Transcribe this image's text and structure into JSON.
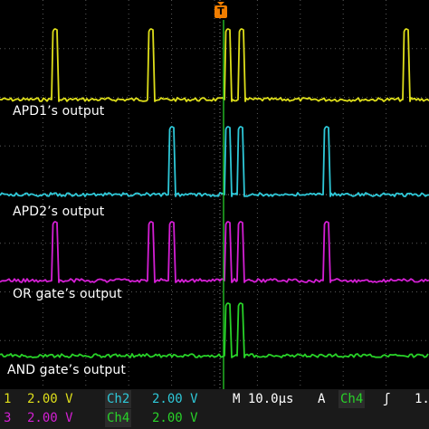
{
  "traces": [
    {
      "label": "APD1’s output",
      "color": "#dede1a"
    },
    {
      "label": "APD2’s output",
      "color": "#2ec8d8"
    },
    {
      "label": "OR gate’s output",
      "color": "#d41fd4"
    },
    {
      "label": "AND gate’s output",
      "color": "#28d228"
    }
  ],
  "trigger_marker": "T",
  "status_bar": {
    "row1": {
      "ch_num": "1",
      "ch_num_color": "#dede1a",
      "ch_scale": "2.00 V",
      "ch_scale_color": "#dede1a",
      "ch2_name": "Ch2",
      "ch2_color": "#2ec8d8",
      "ch2_scale": "2.00 V",
      "timebase": "M 10.0µs",
      "trigger_mode": "A",
      "trigger_source": "Ch4",
      "trigger_source_color": "#28d228",
      "trigger_slope": "ʃ",
      "trigger_level": "1."
    },
    "row2": {
      "ch_num": "3",
      "ch_num_color": "#d41fd4",
      "ch_scale": "2.00 V",
      "ch_scale_color": "#d41fd4",
      "ch4_name": "Ch4",
      "ch4_color": "#28d228",
      "ch4_scale": "2.00 V"
    }
  }
}
